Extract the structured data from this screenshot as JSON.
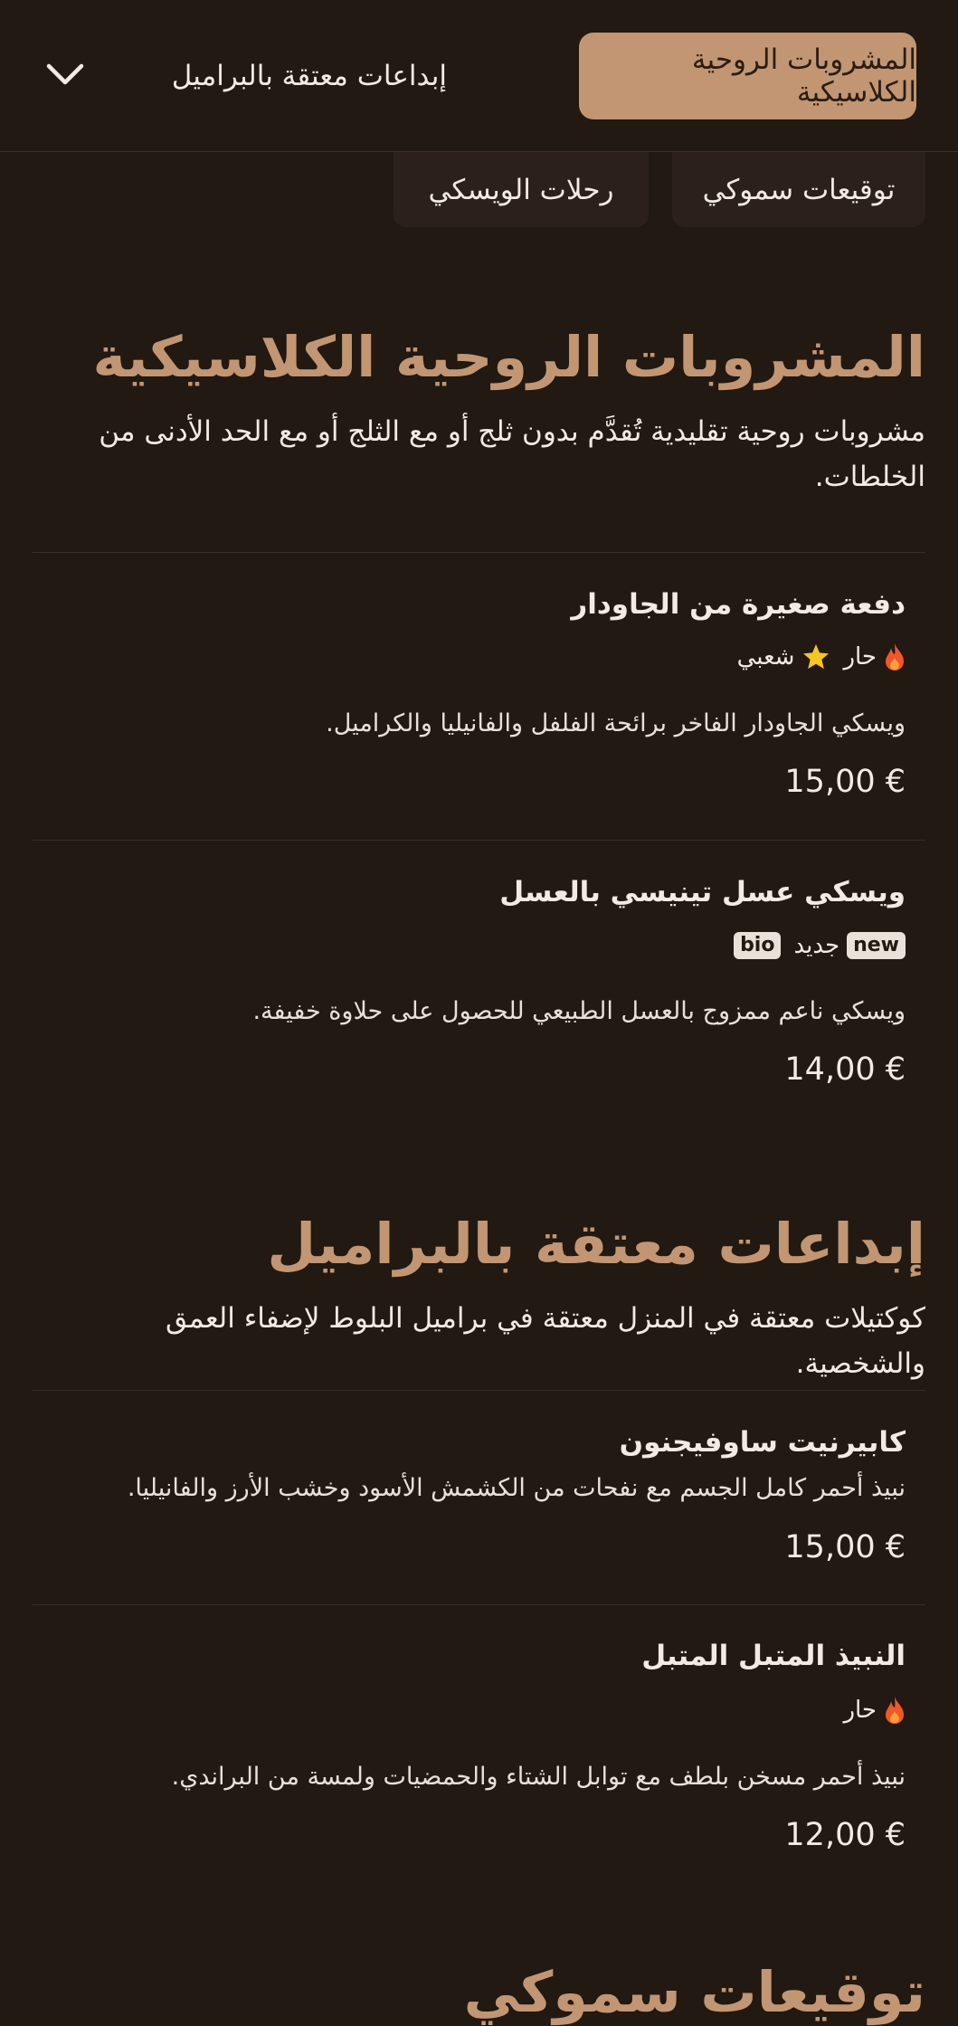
{
  "nav": {
    "categories": [
      {
        "label": "المشروبات الروحية الكلاسيكية",
        "active": true
      },
      {
        "label": "إبداعات معتقة بالبراميل",
        "active": false
      }
    ],
    "chips": [
      {
        "label": "توقيعات سموكي"
      },
      {
        "label": "رحلات الويسكي"
      }
    ],
    "toggle_icon": "chevron-down-icon"
  },
  "sections": [
    {
      "title": "المشروبات الروحية الكلاسيكية",
      "description": "مشروبات روحية تقليدية تُقدَّم بدون ثلج أو مع الثلج أو مع الحد الأدنى من الخلطات.",
      "items": [
        {
          "name": "دفعة صغيرة من الجاودار",
          "badges": {
            "hot": "حار",
            "popular": "شعبي"
          },
          "description": "ويسكي الجاودار الفاخر برائحة الفلفل والفانيليا والكراميل.",
          "price": "15,00 €"
        },
        {
          "name": "ويسكي عسل تينيسي بالعسل",
          "badges": {
            "new_tag": "new",
            "new": "جديد",
            "bio_tag": "bio"
          },
          "description": "ويسكي ناعم ممزوج بالعسل الطبيعي للحصول على حلاوة خفيفة.",
          "price": "14,00 €"
        }
      ]
    },
    {
      "title": "إبداعات معتقة بالبراميل",
      "description": "كوكتيلات معتقة في المنزل معتقة في براميل البلوط لإضفاء العمق والشخصية.",
      "items": [
        {
          "name": "كابيرنيت ساوفيجنون",
          "description": "نبيذ أحمر كامل الجسم مع نفحات من الكشمش الأسود وخشب الأرز والفانيليا.",
          "price": "15,00 €"
        },
        {
          "name": "النبيذ المتبل المتبل",
          "badges": {
            "hot": "حار"
          },
          "description": "نبيذ أحمر مسخن بلطف مع توابل الشتاء والحمضيات ولمسة من البراندي.",
          "price": "12,00 €"
        }
      ]
    },
    {
      "title": "توقيعات سموكي"
    }
  ],
  "colors": {
    "background": "#211912",
    "accent": "#c29673",
    "text": "#f3ebe2",
    "chip_bg": "#2b211a",
    "divider": "#3a2e25",
    "flame": "#f0572a",
    "star": "#f5c524"
  }
}
